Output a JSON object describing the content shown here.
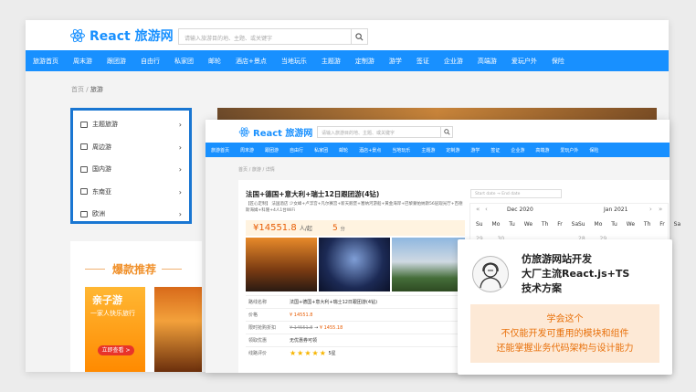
{
  "back": {
    "logo": "React 旅游网",
    "search_placeholder": "请输入旅游目的地、主题、或关键字",
    "nav": [
      "旅游首页",
      "周末游",
      "跟团游",
      "自由行",
      "私家团",
      "邮轮",
      "酒店+景点",
      "当地玩乐",
      "主题游",
      "定制游",
      "游学",
      "签证",
      "企业游",
      "高端游",
      "爱玩户外",
      "保险"
    ],
    "breadcrumb": {
      "home": "首页",
      "sep": "/",
      "current": "旅游"
    },
    "sidebar": [
      "主题旅游",
      "周边游",
      "国内游",
      "东南亚",
      "欧洲"
    ],
    "recommend_title": "爆款推荐",
    "card": {
      "title": "亲子游",
      "subtitle": "一家人快乐旅行",
      "button": "立即查看 >"
    }
  },
  "front": {
    "logo": "React 旅游网",
    "search_placeholder": "请输入旅游目的地、主题、或关键字",
    "nav": [
      "旅游首页",
      "周末游",
      "跟团游",
      "自由行",
      "私家团",
      "邮轮",
      "酒店+景点",
      "当地玩乐",
      "主题游",
      "定制游",
      "游学",
      "签证",
      "企业游",
      "高端游",
      "爱玩户外",
      "保险"
    ],
    "breadcrumb": [
      "首页",
      "/",
      "旅游",
      "/",
      "详情"
    ],
    "product": {
      "title": "法国+德国+意大利+瑞士12日跟团游(4钻)",
      "subtitle": "【匠心定制】 法国酒店 少女峰+卢浮宫+凡尔赛宫+新天鹅堡+塞纳河游船+黄金海岸+巴黎蒙帕纳斯56层观光厅+百德斯海姆+科隆+4人1台WiFi",
      "price": "¥14551.8",
      "price_unit": "人/起",
      "score": "5",
      "score_unit": "分"
    },
    "date_range": {
      "start": "Start date",
      "arrow": "→",
      "end": "End date"
    },
    "details": [
      {
        "key": "路线名称",
        "value": "法国+德国+意大利+瑞士12日跟团游(4钻)"
      },
      {
        "key": "价格",
        "value": "¥ 14551.8"
      },
      {
        "key": "限时抢购折扣",
        "value_old": "¥ 14551.8",
        "value": "¥ 1455.18"
      },
      {
        "key": "领取优惠",
        "value": "无优惠券可领"
      },
      {
        "key": "线路评价",
        "stars": "★★★★★",
        "value": "5星"
      }
    ],
    "calendar": {
      "left_month": "Dec   2020",
      "right_month": "Jan   2021",
      "weekdays_left": "Su Mo Tu We Th Fr Sa",
      "weekdays_right": "Su Mo Tu We Th Fr Sa",
      "dates_left": "29 30",
      "dates_right": "28 29"
    }
  },
  "promo": {
    "title_lines": [
      "仿旅游网站开发",
      "大厂主流React.js+TS",
      "技术方案"
    ],
    "box_lines": [
      "学会这个",
      "不仅能开发可重用的模块和组件",
      "还能掌握业务代码架构与设计能力"
    ]
  },
  "colors": {
    "primary": "#1890ff",
    "accent": "#e85d04",
    "promo_bg": "#fde9d6",
    "promo_text": "#e8700a"
  }
}
